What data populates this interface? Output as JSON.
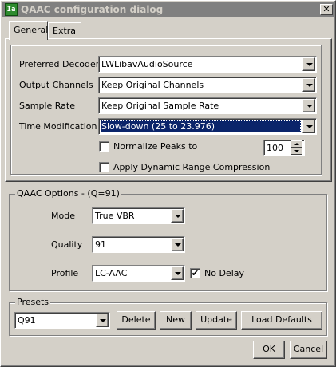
{
  "window": {
    "title": "QAAC configuration dialog",
    "icon": "qaac-app-icon",
    "icon_text": "Ia",
    "close_glyph": "✕"
  },
  "tabs": [
    {
      "label": "General",
      "active": true
    },
    {
      "label": "Extra",
      "active": false
    }
  ],
  "general": {
    "preferred_decoder": {
      "label": "Preferred Decoder",
      "value": "LWLibavAudioSource"
    },
    "output_channels": {
      "label": "Output Channels",
      "value": "Keep Original Channels"
    },
    "sample_rate": {
      "label": "Sample Rate",
      "value": "Keep Original Sample Rate"
    },
    "time_modification": {
      "label": "Time Modification",
      "value": "Slow-down (25 to 23.976)"
    },
    "normalize_peaks": {
      "label": "Normalize Peaks to",
      "checked": false,
      "value": "100"
    },
    "drc": {
      "label": "Apply Dynamic Range Compression",
      "checked": false
    }
  },
  "qaac_options": {
    "legend": "QAAC Options - (Q=91)",
    "mode": {
      "label": "Mode",
      "value": "True VBR"
    },
    "quality": {
      "label": "Quality",
      "value": "91"
    },
    "profile": {
      "label": "Profile",
      "value": "LC-AAC"
    },
    "no_delay": {
      "label": "No Delay",
      "checked": true,
      "mark": "✔"
    }
  },
  "presets": {
    "legend": "Presets",
    "value": "Q91",
    "buttons": {
      "delete": "Delete",
      "new": "New",
      "update": "Update",
      "load_defaults": "Load Defaults"
    }
  },
  "dialog_buttons": {
    "ok": "OK",
    "cancel": "Cancel"
  },
  "colors": {
    "face": "#d4d0c8",
    "titlebar_inactive": "#808080",
    "selection": "#0a246a"
  }
}
